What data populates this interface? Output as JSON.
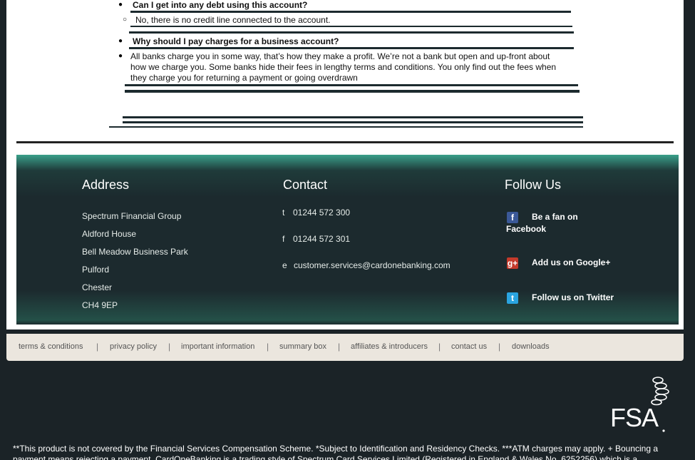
{
  "faq": {
    "q1": "Can I get into any debt using this account?",
    "a1": "No, there is no credit line connected to the account.",
    "q2": "Why should I pay charges for a business account?",
    "a2_line1": "All banks charge you in some way, that’s how they make a profit. We’re not a bank but   open and up-front about",
    "a2_line2": "how we charge you. Some banks hide their fees in lengthy terms and conditions. You only find out the fees when",
    "a2_line3": "they charge you for returning a payment or going overdrawn"
  },
  "footer": {
    "address": {
      "title": "Address",
      "lines": [
        "Spectrum Financial Group",
        "Aldford House",
        "Bell Meadow Business Park",
        "Pulford",
        "Chester",
        "CH4 9EP"
      ]
    },
    "contact": {
      "title": "Contact",
      "phone_prefix": "t",
      "phone": "01244 572 300",
      "fax_prefix": "f",
      "fax": "01244 572 301",
      "email_prefix": "e",
      "email": "customer.services@cardonebanking.com"
    },
    "follow": {
      "title": "Follow Us",
      "facebook_line1": "Be a fan on",
      "facebook_line2": "Facebook",
      "google": "Add us on Google+",
      "twitter": "Follow us on Twitter"
    }
  },
  "nav": {
    "items": [
      "terms & conditions",
      "privacy policy",
      "important information",
      "summary box",
      "affiliates & introducers",
      "contact us",
      "downloads"
    ],
    "separator": "|"
  },
  "fsa": {
    "label": "FSA"
  },
  "disclaimer": {
    "line1": "**This product is not covered by the Financial Services Compensation Scheme. *Subject to Identification and Residency Checks. ***ATM charges may apply. + Bouncing a",
    "line2": "payment means rejecting a payment. CardOneBanking is a trading style of Spectrum Card Services Limited (Registered in England & Wales No. 6252256) which is a"
  },
  "colors": {
    "footer_bg": "#1c2a2e",
    "footer_accent": "#3aa08a",
    "nav_bg": "#ebe6de"
  }
}
